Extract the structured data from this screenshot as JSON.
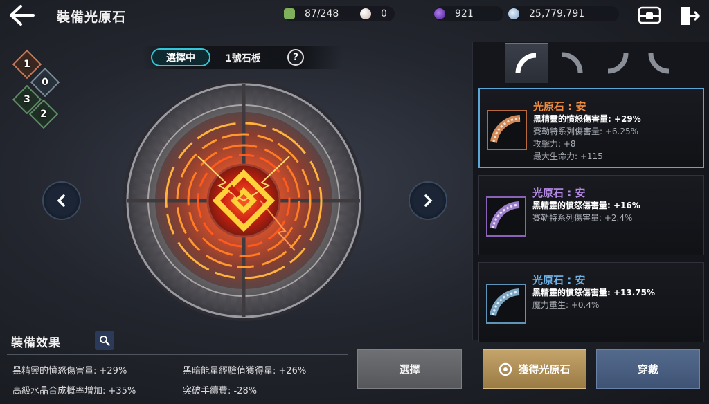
{
  "header": {
    "title": "裝備光原石",
    "resources": [
      {
        "name": "stamina",
        "value": "87/248",
        "color": "#7fb05a"
      },
      {
        "name": "pearl",
        "value": "0",
        "color": "#d9c8c0"
      },
      {
        "name": "dark-essence",
        "value": "921",
        "color": "#7a3fc4"
      },
      {
        "name": "silver",
        "value": "25,779,791",
        "color": "#9ab8d8"
      }
    ]
  },
  "selector": {
    "selected_label": "選擇中",
    "board_label": "1號石板",
    "help_label": "?"
  },
  "gems": [
    {
      "label": "1",
      "color": "#c47a58"
    },
    {
      "label": "0",
      "color": "#7a8a96"
    },
    {
      "label": "3",
      "color": "#5f8c66"
    },
    {
      "label": "2",
      "color": "#5f8c66"
    }
  ],
  "effects": {
    "title": "裝備效果",
    "items": [
      "黑精靈的憤怒傷害量: +29%",
      "黑暗能量經驗值獲得量: +26%",
      "高級水晶合成概率增加: +35%",
      "突破手續費: -28%"
    ]
  },
  "buttons": {
    "select": "選擇",
    "obtain": "獲得光原石",
    "equip": "穿戴"
  },
  "stones": [
    {
      "name": "光原石 : 安",
      "rarity_color": "#f08a3a",
      "stats": [
        "黑精靈的憤怒傷害量: +29%",
        "賽勒特系列傷害量: +6.25%",
        "攻擊力: +8",
        "最大生命力: +115"
      ]
    },
    {
      "name": "光原石 : 安",
      "rarity_color": "#b78ae8",
      "stats": [
        "黑精靈的憤怒傷害量: +16%",
        "賽勒特系列傷害量: +2.4%"
      ]
    },
    {
      "name": "光原石 : 安",
      "rarity_color": "#6fb4e8",
      "stats": [
        "黑精靈的憤怒傷害量: +13.75%",
        "魔力重生: +0.4%"
      ]
    }
  ],
  "colors": {
    "accent_cyan": "#33c6d6",
    "selected_border": "#5aa6d8",
    "gold_button": "#c4a46a",
    "blue_button": "#546a8c"
  }
}
